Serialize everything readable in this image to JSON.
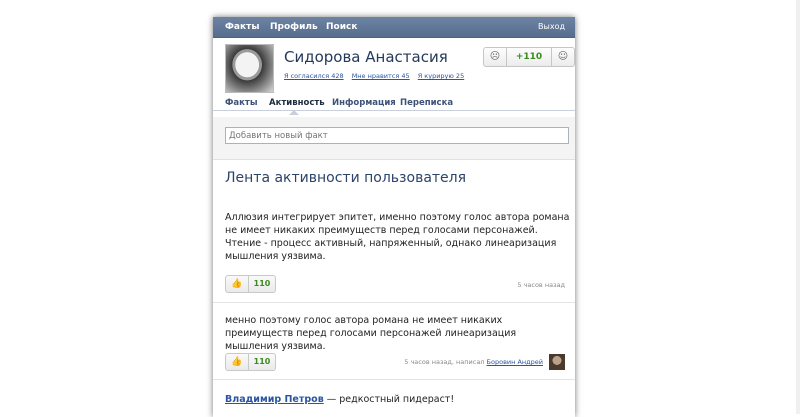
{
  "topnav": {
    "facts": "Факты",
    "profile": "Профиль",
    "search": "Поиск",
    "exit": "Выход"
  },
  "profile": {
    "name": "Сидорова Анастасия",
    "stats": [
      "Я согласился 428",
      "Мне нравится 45",
      "Я курирую 25"
    ],
    "vote": {
      "down": "☹",
      "score": "+110",
      "up": "☺"
    }
  },
  "tabs": [
    "Факты",
    "Активность",
    "Информация",
    "Переписка"
  ],
  "fact_input": {
    "placeholder": "Добавить новый факт"
  },
  "feed": {
    "title": "Лента активности пользователя",
    "posts": [
      {
        "text": "Аллюзия интегрирует эпитет, именно поэтому голос автора романа не имеет никаких преимуществ перед голосами персонажей. Чтение - процесс активный, напряженный, однако линеаризация мышления уязвима.",
        "likes": "110",
        "time": "5 часов назад"
      },
      {
        "text": "менно поэтому голос автора романа не имеет никаких преимуществ перед голосами персонажей линеаризация мышления уязвима.",
        "likes": "110",
        "time": "5 часов назад, написал",
        "author": "Боровин Андрей"
      }
    ],
    "comment": {
      "author": "Владимир Петров",
      "dash": " — ",
      "text": "редкостный пидераст!"
    }
  }
}
